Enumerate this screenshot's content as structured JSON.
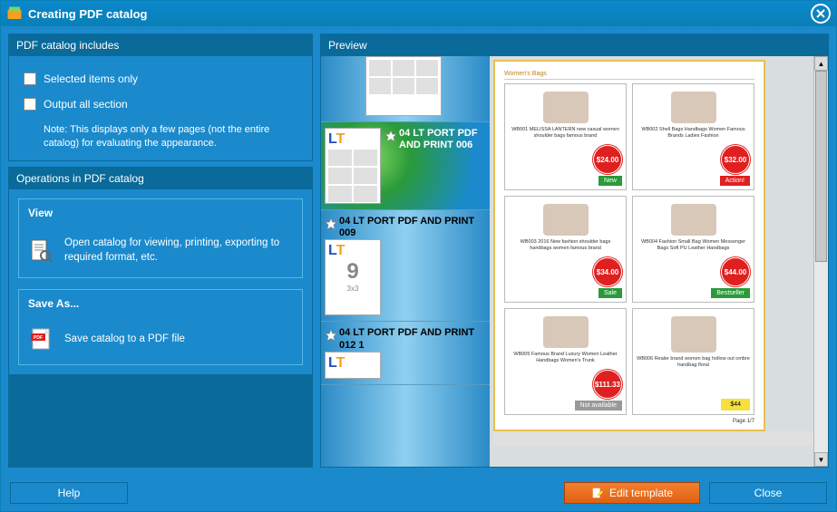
{
  "window": {
    "title": "Creating PDF catalog"
  },
  "left": {
    "includes_header": "PDF catalog includes",
    "opt_selected": "Selected items only",
    "opt_output_all": "Output all section",
    "note": "Note: This displays only a few pages (not the entire catalog) for evaluating the appearance.",
    "ops_header": "Operations in PDF catalog",
    "view": {
      "title": "View",
      "desc": "Open catalog for viewing, printing, exporting to required format, etc."
    },
    "saveas": {
      "title": "Save As...",
      "desc": "Save catalog to a PDF file"
    }
  },
  "preview": {
    "header": "Preview",
    "templates": [
      {
        "label": ""
      },
      {
        "label": "04 LT PORT PDF AND PRINT 006",
        "selected": true
      },
      {
        "label": "04 LT PORT PDF AND PRINT 009"
      },
      {
        "label": "04 LT PORT PDF AND PRINT 012 1"
      }
    ],
    "page": {
      "category": "Women's Bags",
      "page_num": "Page 1/7",
      "products": [
        {
          "name": "WB001 MELISSA LANTERN new casual women shoulder bags famous brand",
          "price": "$24.00",
          "badge": "New",
          "badge_class": "green"
        },
        {
          "name": "WB002 Shell Bags Handbags Women Famous Brands Ladies Fashion",
          "price": "$32.00",
          "badge": "Action!",
          "badge_class": "red"
        },
        {
          "name": "WB003 2016 New fashion shoulder bags handbags women famous brand",
          "price": "$34.00",
          "badge": "Sale",
          "badge_class": "green"
        },
        {
          "name": "WB004 Fashion Small Bag Women Messenger Bags Soft PU Leather Handbags",
          "price": "$44.00",
          "badge": "Bestseller",
          "badge_class": "green"
        },
        {
          "name": "WB005 Famous Brand Luxury Women Leather Handbags Women's Trunk",
          "price": "$111.33",
          "badge": "Not available",
          "badge_class": "gray"
        },
        {
          "name": "WB006 Realer brand women bag hollow out ombre handbag floral",
          "price": "$44",
          "badge": "$44",
          "badge_class": "yellow",
          "noprice": true
        }
      ]
    }
  },
  "footer": {
    "help": "Help",
    "edit": "Edit template",
    "close": "Close"
  }
}
